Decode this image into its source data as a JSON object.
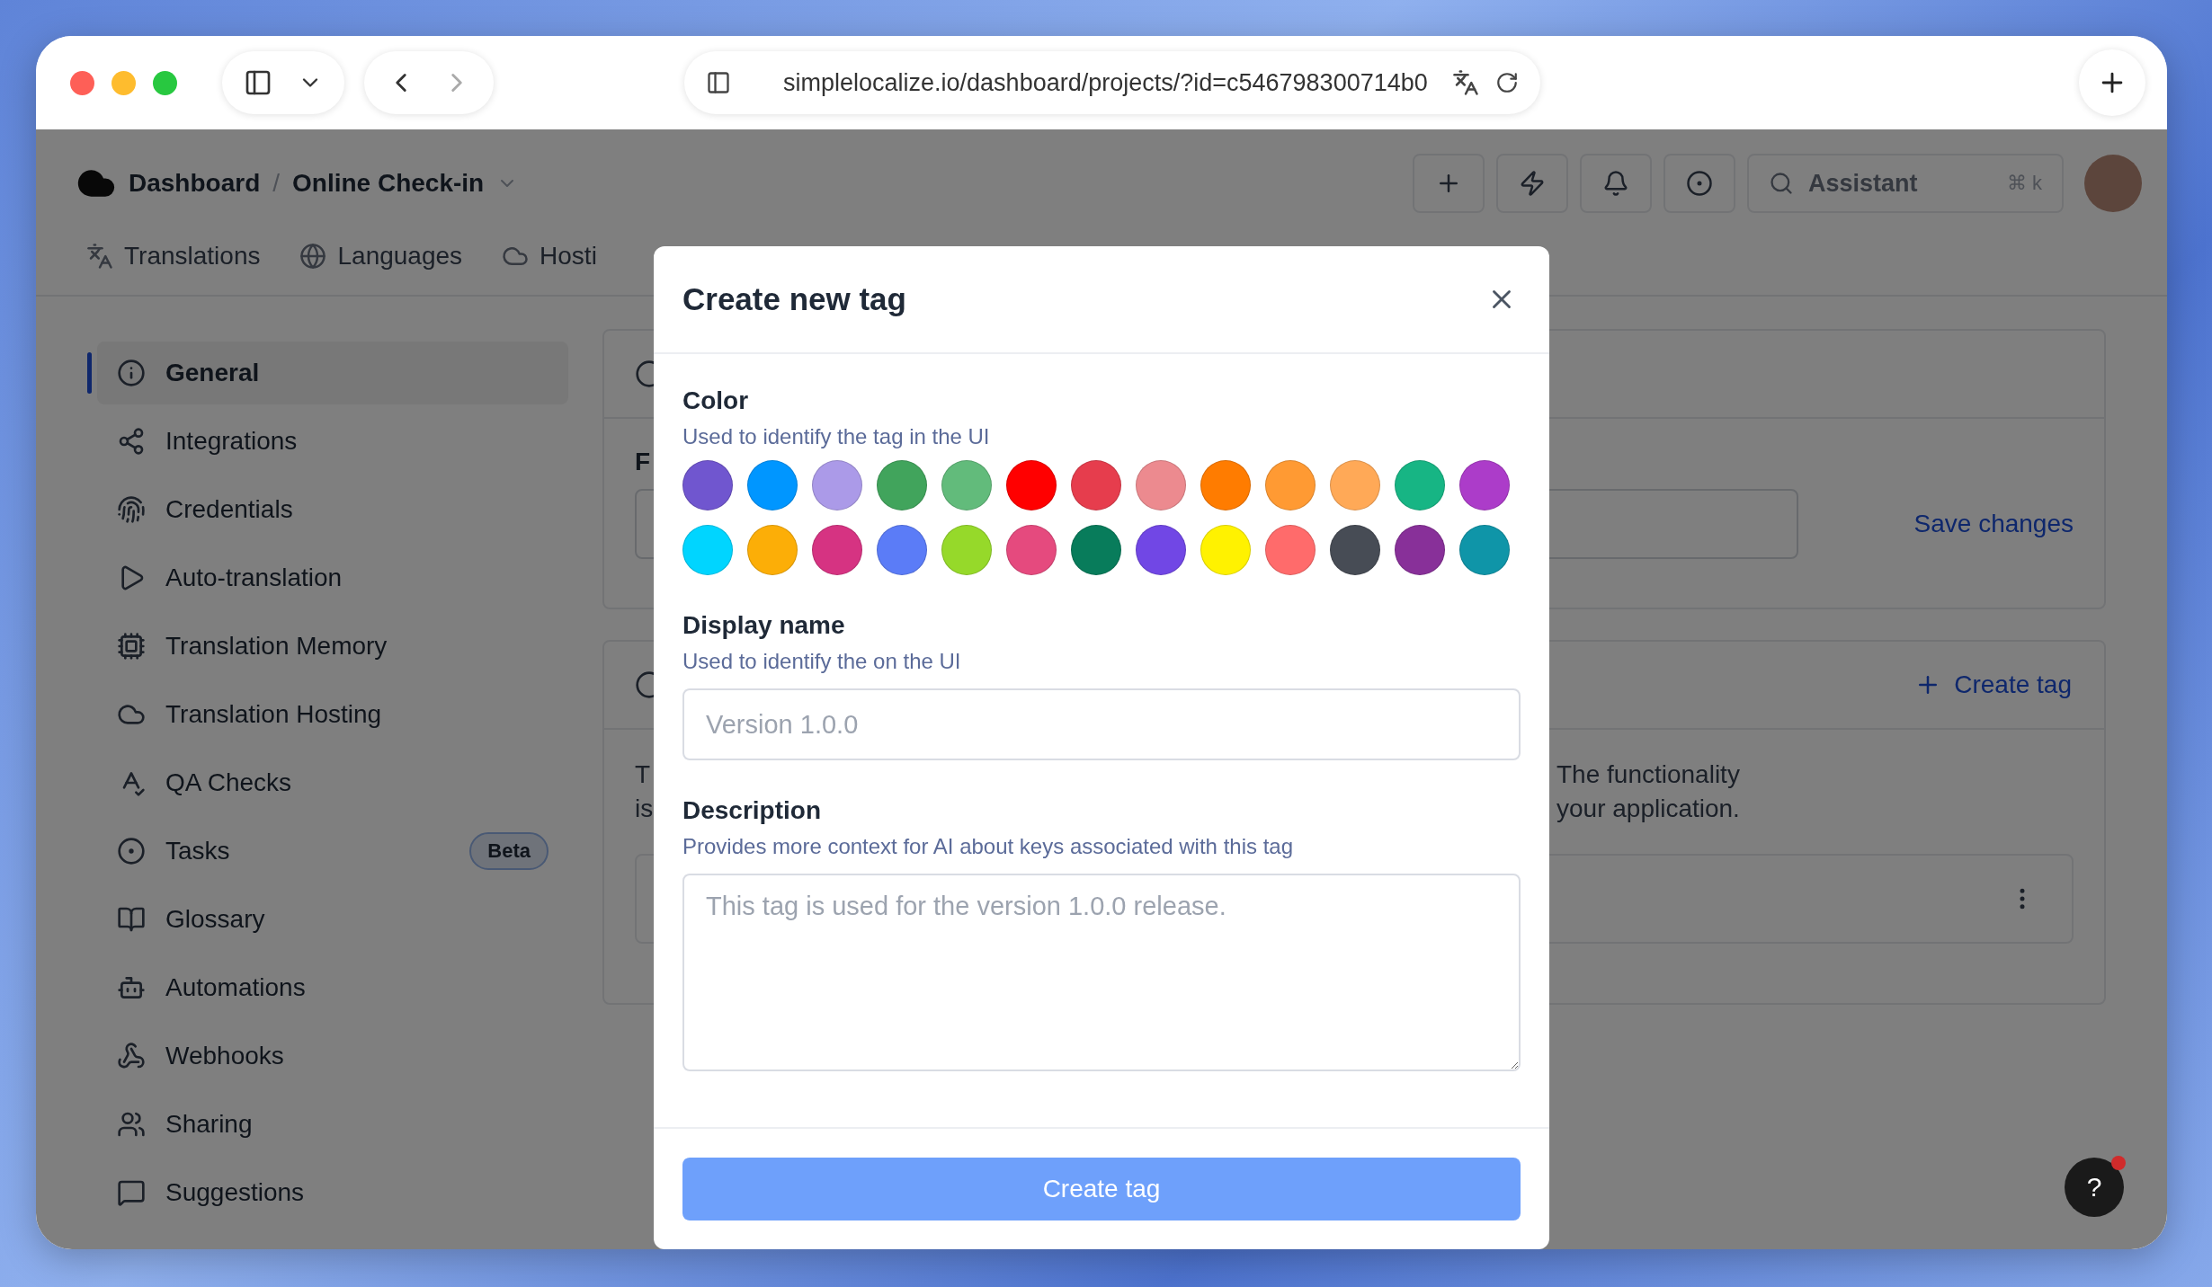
{
  "browser": {
    "url": "simplelocalize.io/dashboard/projects/?id=c546798300714b0"
  },
  "header": {
    "breadcrumb": [
      "Dashboard",
      "Online Check-in"
    ],
    "separator": "/",
    "search": {
      "placeholder": "Assistant",
      "shortcut": "⌘ k"
    }
  },
  "tabs": [
    {
      "label": "Translations",
      "selected": false
    },
    {
      "label": "Languages",
      "selected": false
    },
    {
      "label": "Hosti",
      "selected": false
    }
  ],
  "sidebar": {
    "items": [
      {
        "label": "General",
        "selected": true
      },
      {
        "label": "Integrations",
        "selected": false
      },
      {
        "label": "Credentials",
        "selected": false
      },
      {
        "label": "Auto-translation",
        "selected": false
      },
      {
        "label": "Translation Memory",
        "selected": false
      },
      {
        "label": "Translation Hosting",
        "selected": false
      },
      {
        "label": "QA Checks",
        "selected": false
      },
      {
        "label": "Tasks",
        "selected": false,
        "badge": "Beta"
      },
      {
        "label": "Glossary",
        "selected": false
      },
      {
        "label": "Automations",
        "selected": false
      },
      {
        "label": "Webhooks",
        "selected": false
      },
      {
        "label": "Sharing",
        "selected": false
      },
      {
        "label": "Suggestions",
        "selected": false
      }
    ]
  },
  "cards": [
    {
      "field_label": "F",
      "action": "Save changes"
    },
    {
      "action": "Create tag",
      "text_left": [
        "T",
        "is"
      ],
      "text_right": [
        "The functionality",
        "your application."
      ]
    }
  ],
  "help": {
    "label": "?"
  },
  "modal": {
    "title": "Create new tag",
    "color": {
      "label": "Color",
      "hint": "Used to identify the tag in the UI",
      "swatches": [
        {
          "color": "#7056cf",
          "selected": false
        },
        {
          "color": "#0096ff",
          "selected": false
        },
        {
          "color": "#ab9ae8",
          "selected": false
        },
        {
          "color": "#41a45c",
          "selected": false
        },
        {
          "color": "#62bb7b",
          "selected": false
        },
        {
          "color": "#ff0000",
          "selected": false
        },
        {
          "color": "#e63d4d",
          "selected": false
        },
        {
          "color": "#ec8a8f",
          "selected": false
        },
        {
          "color": "#ff7c00",
          "selected": false
        },
        {
          "color": "#ff9a33",
          "selected": false
        },
        {
          "color": "#ffa957",
          "selected": false
        },
        {
          "color": "#17b584",
          "selected": false
        },
        {
          "color": "#ac3cc9",
          "selected": false
        },
        {
          "color": "#00d5ff",
          "selected": false
        },
        {
          "color": "#fcae07",
          "selected": false
        },
        {
          "color": "#d63382",
          "selected": false
        },
        {
          "color": "#5b7cf7",
          "selected": false
        },
        {
          "color": "#96d92a",
          "selected": false
        },
        {
          "color": "#e54a7e",
          "selected": false
        },
        {
          "color": "#087c5b",
          "selected": false
        },
        {
          "color": "#7147e5",
          "selected": false
        },
        {
          "color": "#fff200",
          "selected": false
        },
        {
          "color": "#ff6b6b",
          "selected": false
        },
        {
          "color": "#474c55",
          "selected": false
        },
        {
          "color": "#883099",
          "selected": false
        },
        {
          "color": "#0f95a8",
          "selected": false
        }
      ]
    },
    "display_name": {
      "label": "Display name",
      "hint": "Used to identify the on the UI",
      "placeholder": "Version 1.0.0"
    },
    "description": {
      "label": "Description",
      "hint": "Provides more context for AI about keys associated with this tag",
      "placeholder": "This tag is used for the version 1.0.0 release."
    },
    "submit": "Create tag"
  }
}
